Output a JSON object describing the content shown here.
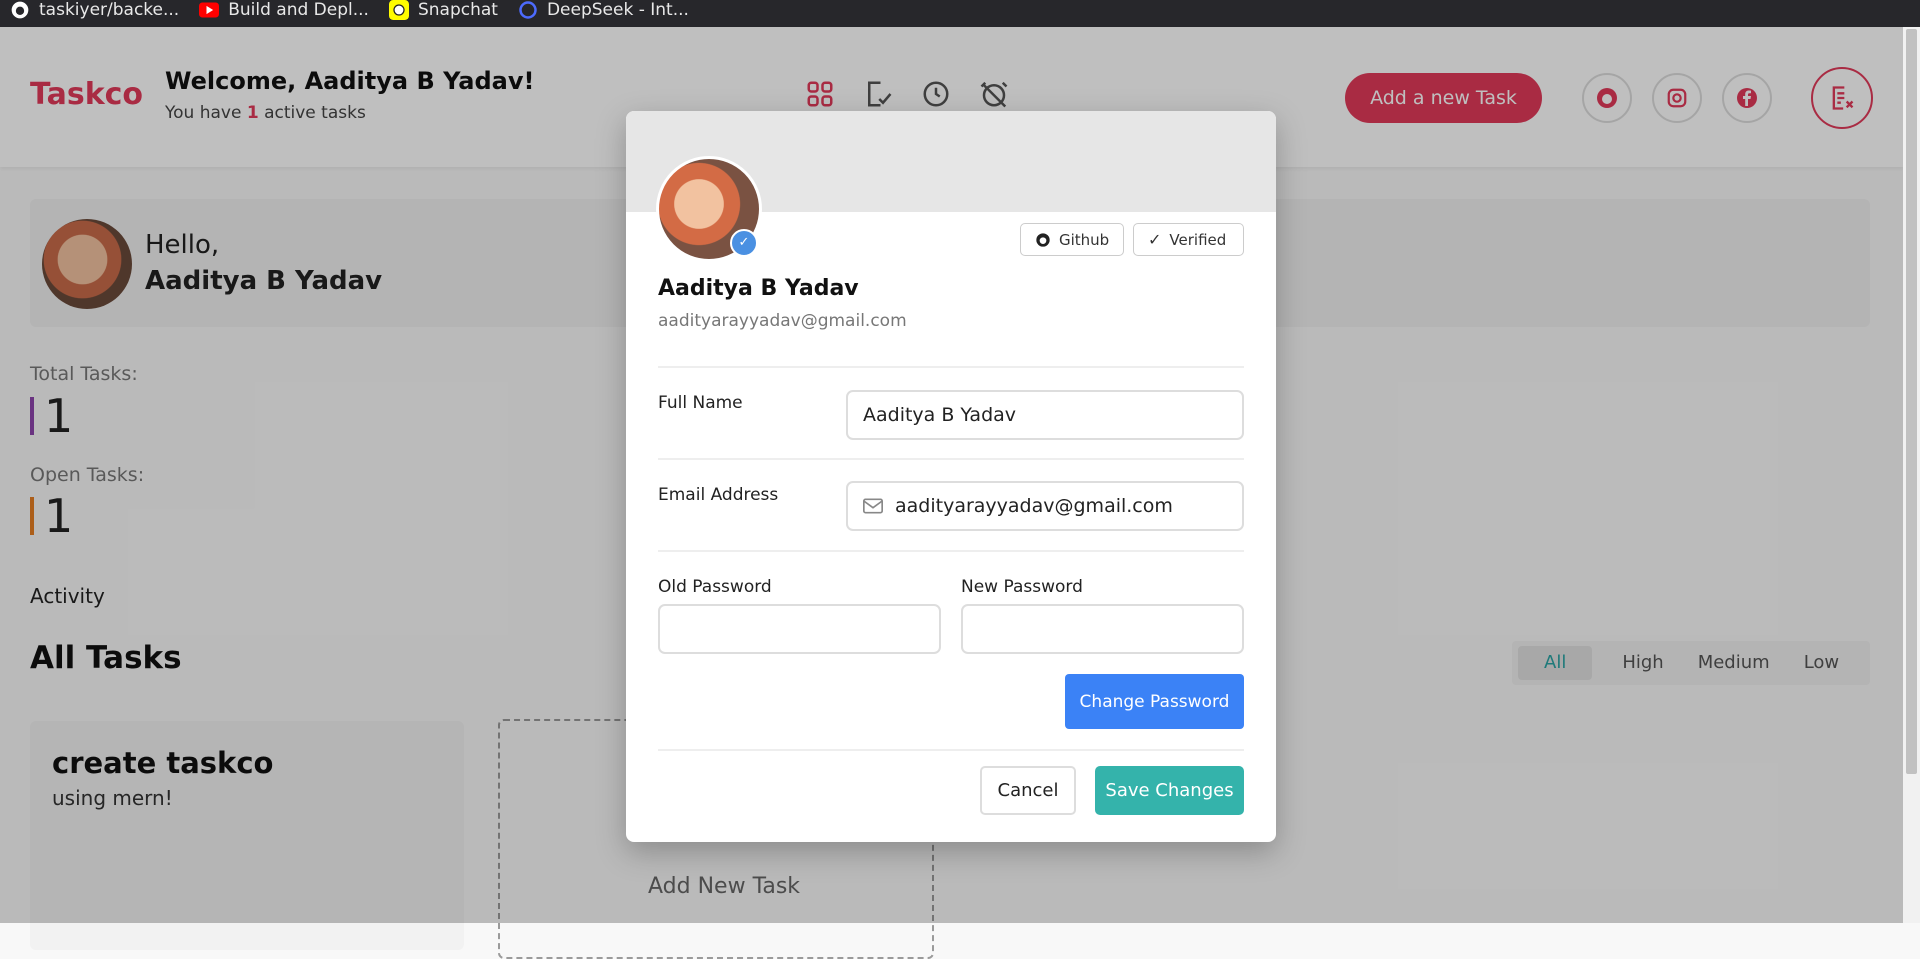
{
  "browser": {
    "bookmarks": [
      {
        "label": "taskiyer/backe...",
        "icon": "github-icon",
        "color": "#ffffff"
      },
      {
        "label": "Build and Depl...",
        "icon": "youtube-icon",
        "color": "#ff0000"
      },
      {
        "label": "Snapchat",
        "icon": "snapchat-icon",
        "color": "#fffc00"
      },
      {
        "label": "DeepSeek - Int...",
        "icon": "deepseek-icon",
        "color": "#4d6bfe"
      }
    ]
  },
  "header": {
    "logo": "Taskco",
    "welcome": "Welcome, Aaditya B Yadav!",
    "sub_prefix": "You have",
    "active_count": "1",
    "sub_suffix": "active tasks",
    "add_task_label": "Add a new Task",
    "nav_icons": [
      "grid-icon",
      "check-task-icon",
      "clock-icon",
      "alarm-off-icon"
    ],
    "social_icons": [
      "github-icon",
      "instagram-icon",
      "facebook-icon"
    ],
    "profile_icon": "profile-list-icon",
    "accent_color": "#e23a5a"
  },
  "greeting": {
    "hello": "Hello,",
    "name": "Aaditya B Yadav"
  },
  "stats": {
    "total_label": "Total Tasks:",
    "total_value": "1",
    "total_color": "#8e44ad",
    "open_label": "Open Tasks:",
    "open_value": "1",
    "open_color": "#e67e22"
  },
  "activity_label": "Activity",
  "tasks": {
    "heading": "All Tasks",
    "filters": [
      "All",
      "High",
      "Medium",
      "Low"
    ],
    "active_filter": "All",
    "items": [
      {
        "title": "create taskco",
        "description": "using mern!"
      }
    ],
    "add_new_label": "Add New Task"
  },
  "modal": {
    "github_label": "Github",
    "verified_label": "Verified",
    "name": "Aaditya B Yadav",
    "email": "aadityarayyadav@gmail.com",
    "full_name_label": "Full Name",
    "full_name_value": "Aaditya B Yadav",
    "email_label": "Email Address",
    "email_value": "aadityarayyadav@gmail.com",
    "old_password_label": "Old Password",
    "new_password_label": "New Password",
    "old_password_value": "",
    "new_password_value": "",
    "change_password_label": "Change Password",
    "cancel_label": "Cancel",
    "save_label": "Save Changes",
    "primary_color": "#3b82f6",
    "save_color": "#34b3ab"
  }
}
